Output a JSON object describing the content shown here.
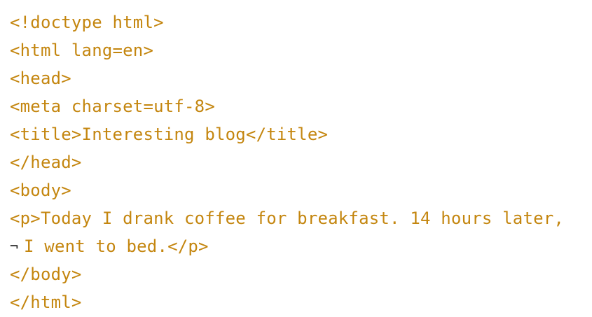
{
  "code": {
    "lines": [
      "<!doctype html>",
      "<html lang=en>",
      "<head>",
      "<meta charset=utf-8>",
      "<title>Interesting blog</title>",
      "</head>",
      "<body>",
      "<p>Today I drank coffee for breakfast. 14 hours later,",
      "I went to bed.</p>",
      "</body>",
      "</html>"
    ],
    "wrap_marker": "¬"
  },
  "colors": {
    "code_text": "#c4860f",
    "wrap_marker": "#222222",
    "background": "#ffffff"
  }
}
